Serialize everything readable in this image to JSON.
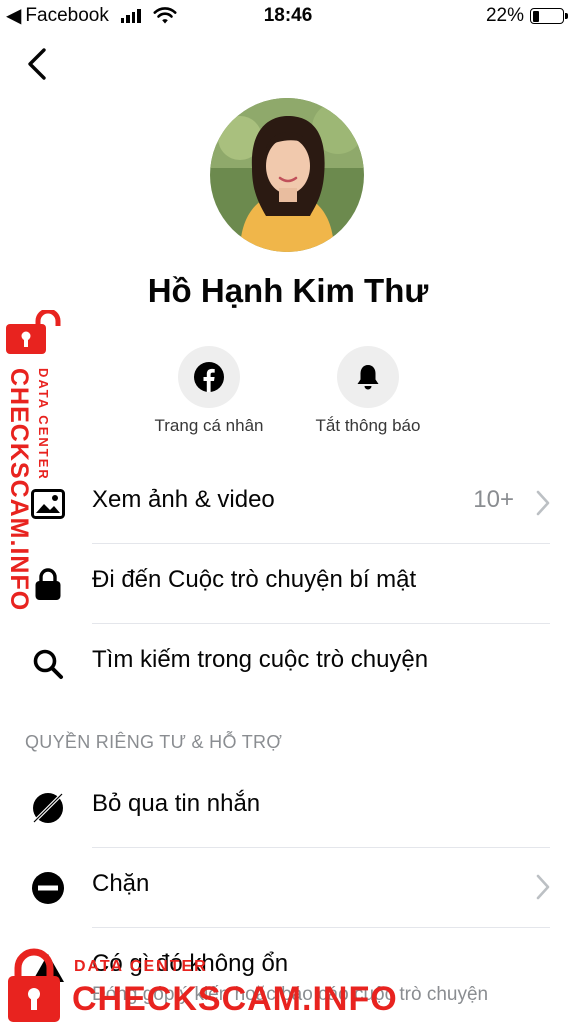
{
  "status_bar": {
    "back_app": "Facebook",
    "time": "18:46",
    "battery": "22%",
    "battery_level": 0.22
  },
  "profile": {
    "name": "Hồ Hạnh Kim Thư"
  },
  "actions": [
    {
      "label": "Trang cá nhân",
      "icon": "facebook-icon"
    },
    {
      "label": "Tắt thông báo",
      "icon": "bell-icon"
    }
  ],
  "menu": [
    {
      "label": "Xem ảnh & video",
      "count": "10+",
      "icon": "photo-icon"
    },
    {
      "label": "Đi đến Cuộc trò chuyện bí mật",
      "icon": "lock-icon"
    },
    {
      "label": "Tìm kiếm trong cuộc trò chuyện",
      "icon": "search-icon"
    }
  ],
  "privacy": {
    "header": "QUYỀN RIÊNG TƯ & HỖ TRỢ",
    "items": [
      {
        "label": "Bỏ qua tin nhắn",
        "icon": "ignore-icon"
      },
      {
        "label": "Chặn",
        "icon": "block-icon"
      },
      {
        "label": "Có gì đó không ổn",
        "subtext": "Đóng góp ý kiến hoặc báo cáo cuộc trò chuyện",
        "icon": "warning-icon"
      }
    ]
  },
  "watermark": {
    "brand": "CHECKSCAM.INFO",
    "tagline": "DATA CENTER"
  },
  "colors": {
    "accent_red": "#e8231f",
    "secondary_text": "#8a8d91",
    "divider": "#e4e6eb",
    "icon_bg": "#eeeeee"
  }
}
